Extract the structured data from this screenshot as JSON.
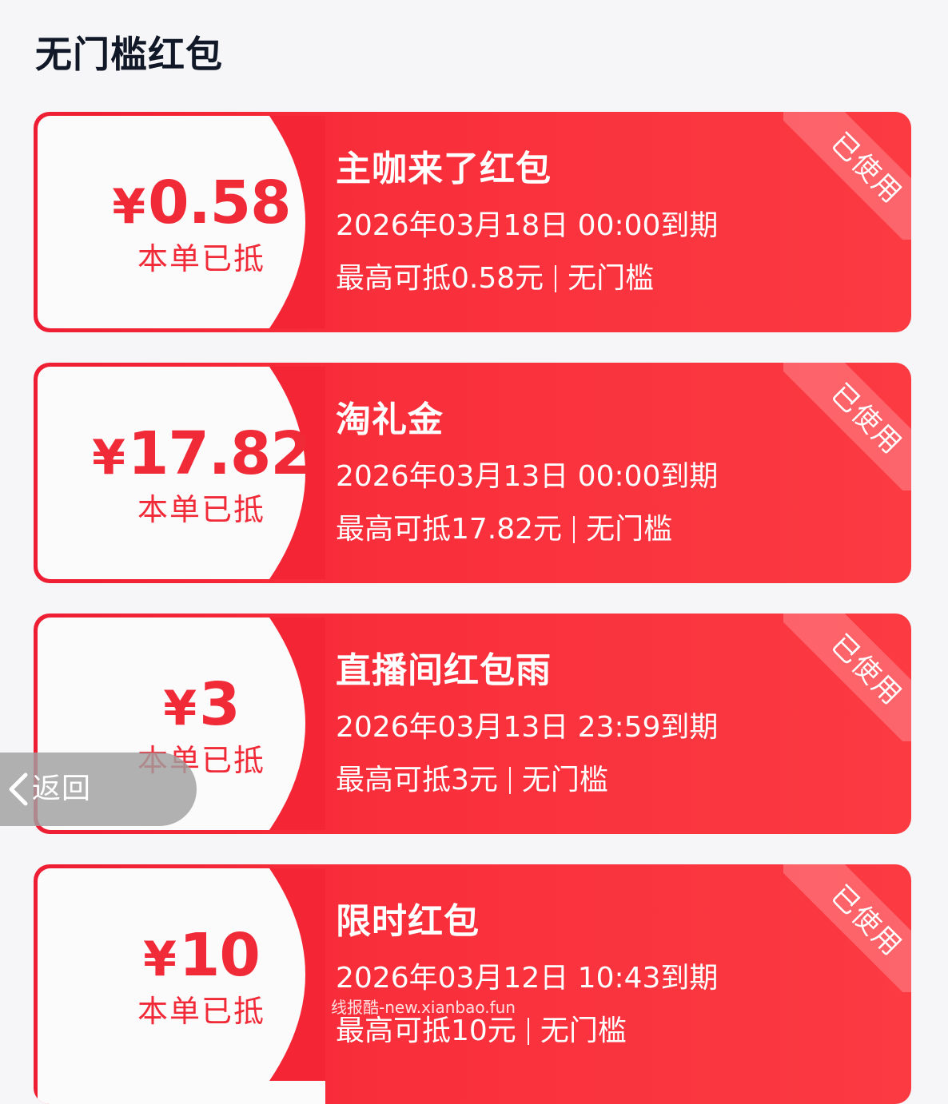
{
  "page": {
    "title": "无门槛红包"
  },
  "coupons": [
    {
      "currency": "¥",
      "amount": "0.58",
      "deducted_label": "本单已抵",
      "name": "主咖来了红包",
      "expire": "2026年03月18日 00:00到期",
      "limit_max": "最高可抵0.58元",
      "limit_threshold": "无门槛",
      "status": "已使用"
    },
    {
      "currency": "¥",
      "amount": "17.82",
      "deducted_label": "本单已抵",
      "name": "淘礼金",
      "expire": "2026年03月13日 00:00到期",
      "limit_max": "最高可抵17.82元",
      "limit_threshold": "无门槛",
      "status": "已使用"
    },
    {
      "currency": "¥",
      "amount": "3",
      "deducted_label": "本单已抵",
      "name": "直播间红包雨",
      "expire": "2026年03月13日 23:59到期",
      "limit_max": "最高可抵3元",
      "limit_threshold": "无门槛",
      "status": "已使用"
    },
    {
      "currency": "¥",
      "amount": "10",
      "deducted_label": "本单已抵",
      "name": "限时红包",
      "expire": "2026年03月12日 10:43到期",
      "limit_max": "最高可抵10元",
      "limit_threshold": "无门槛",
      "status": "已使用"
    }
  ],
  "back_button": {
    "label": "返回",
    "icon": "chevron-left-icon"
  },
  "watermark": "线报酷-new.xianbao.fun",
  "colors": {
    "card_red": "#f92f3b",
    "amount_red": "#f12a38",
    "title_text": "#111827"
  }
}
